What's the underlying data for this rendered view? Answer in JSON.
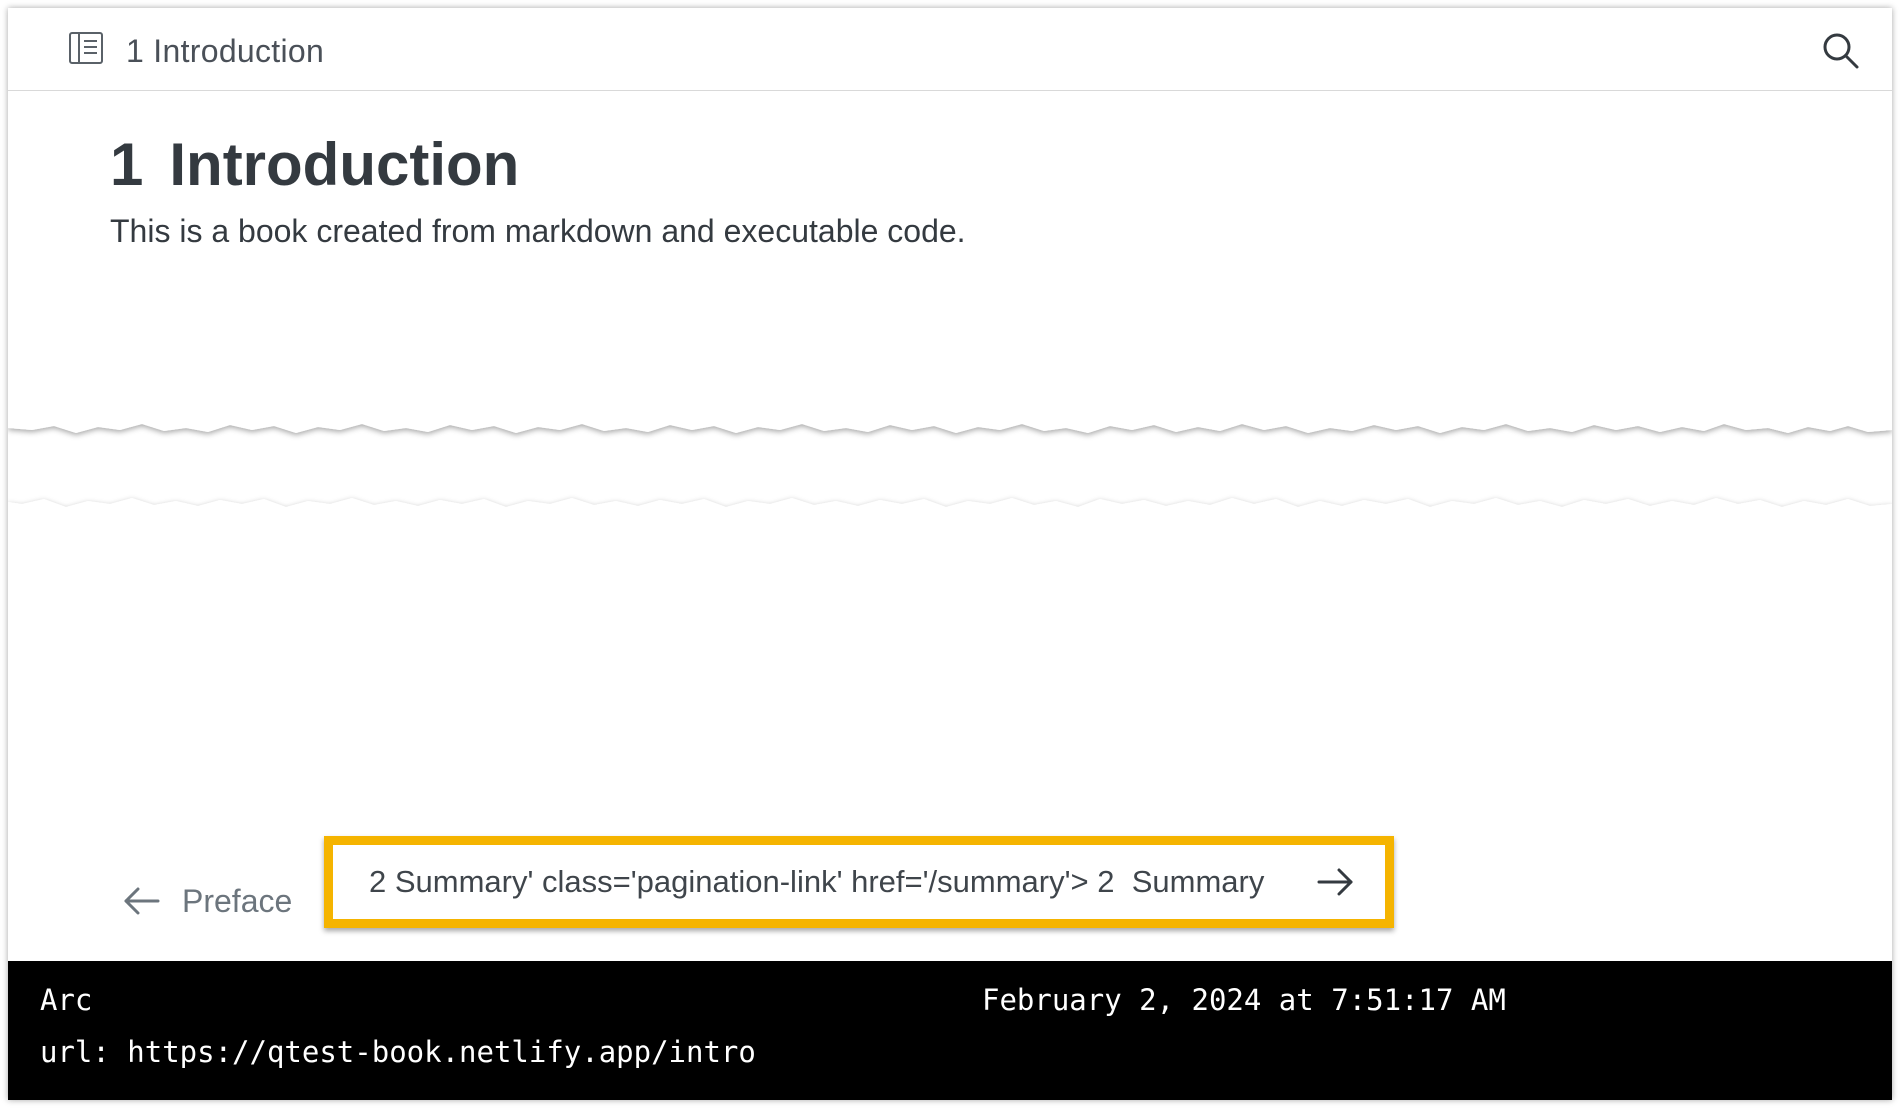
{
  "header": {
    "toc_icon": "toc-icon",
    "title": "1  Introduction",
    "search_icon": "search-icon"
  },
  "main": {
    "chapter_number": "1",
    "chapter_title": "Introduction",
    "body_text": "This is a book created from markdown and executable code."
  },
  "pagination": {
    "prev_label": "Preface",
    "prev_icon": "arrow-left-icon",
    "next_label": "2 Summary' class='pagination-link' href='/summary'> 2  Summary",
    "next_icon": "arrow-right-icon",
    "highlight_color": "#f5b400"
  },
  "status": {
    "app": "Arc",
    "datetime": "February 2, 2024 at 7:51:17 AM",
    "url": "url: https://qtest-book.netlify.app/intro"
  }
}
